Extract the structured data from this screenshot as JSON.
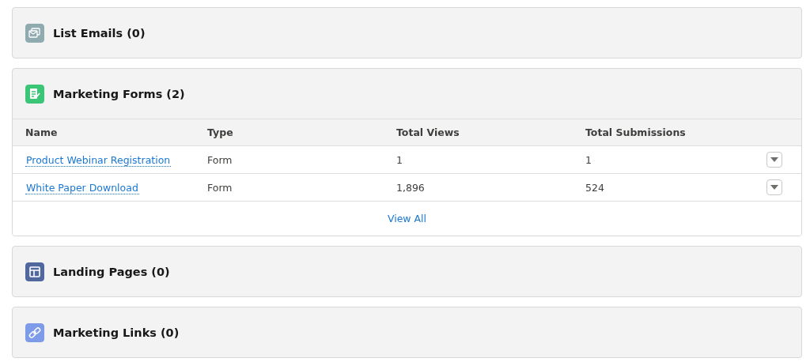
{
  "cards": [
    {
      "kind": "list-email",
      "title": "List Emails (0)"
    },
    {
      "kind": "form",
      "title": "Marketing Forms (2)",
      "table": {
        "columns": [
          "Name",
          "Type",
          "Total Views",
          "Total Submissions"
        ],
        "rows": [
          {
            "name": "Product Webinar Registration",
            "type": "Form",
            "total_views": "1",
            "total_submissions": "1"
          },
          {
            "name": "White Paper Download",
            "type": "Form",
            "total_views": "1,896",
            "total_submissions": "524"
          }
        ]
      },
      "footer_link": "View All"
    },
    {
      "kind": "landing-page",
      "title": "Landing Pages (0)"
    },
    {
      "kind": "link",
      "title": "Marketing Links (0)"
    }
  ]
}
